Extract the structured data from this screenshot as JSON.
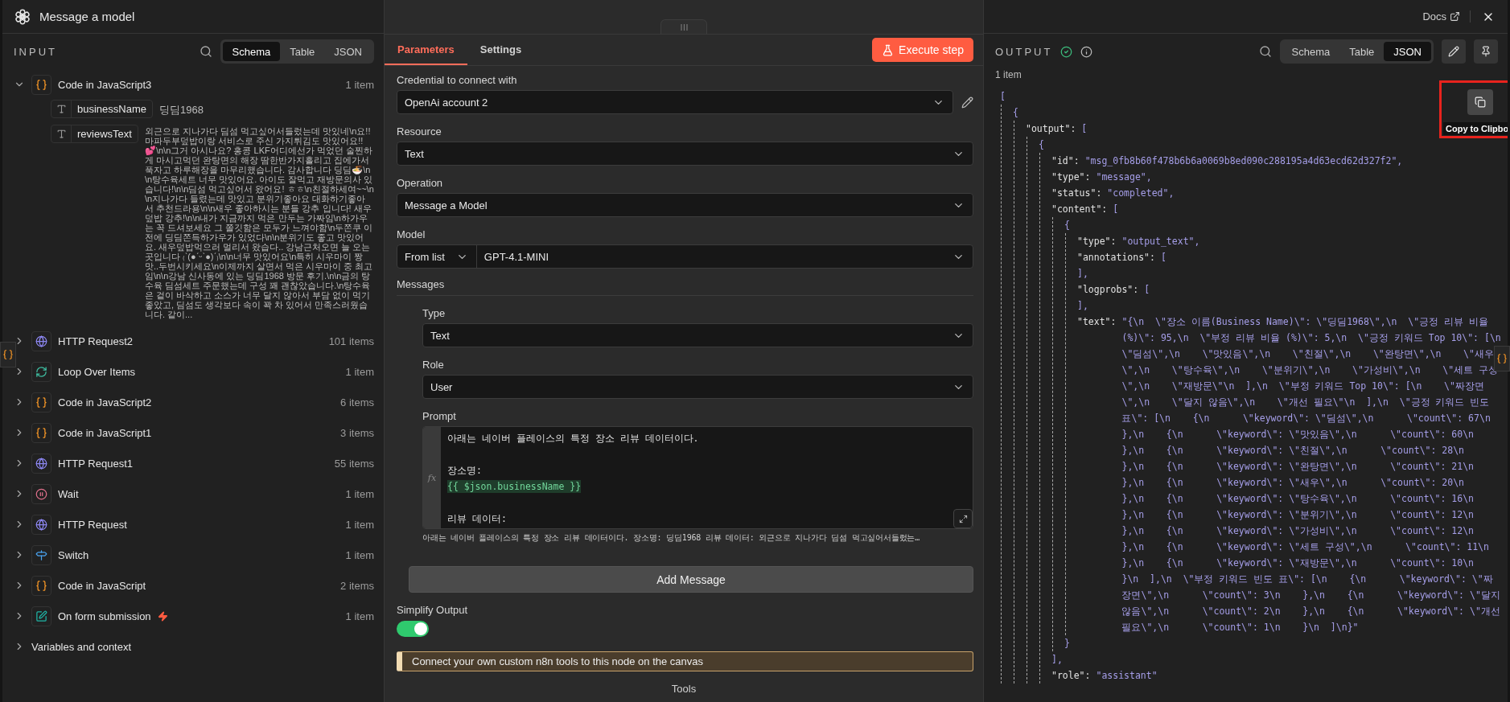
{
  "header": {
    "title": "Message a model",
    "docs": "Docs"
  },
  "input": {
    "title": "INPUT",
    "views": [
      {
        "label": "Schema",
        "selected": true
      },
      {
        "label": "Table",
        "selected": false
      },
      {
        "label": "JSON",
        "selected": false
      }
    ],
    "nodes": [
      {
        "kind": "code",
        "name": "Code in JavaScript3",
        "count": "1 item",
        "expanded": true,
        "trigger": false,
        "fields": [
          {
            "name": "businessName",
            "value": "딩딤1968"
          },
          {
            "name": "reviewsText",
            "value": "외근으로 지나가다 딤섬 먹고싶어서들렀는데 맛있네\\n요!! 마파두부덮밥이랑 서비스로 주신 가지튀김도 맛있어요!!💕\\n\\n그거 아시나요? 홍콩 LKF어디에선가 먹었던 술찐하게 마시고먹던 완탕면의 해장 땀한반가지흘리고 집에가서 푹자고 하루해장을 마무리했습니다. 감사합니다 딩딤🍜\\n\\n탕수육세트 너무 맛있어요. 아이도 잘먹고 재방문의사 있습니다!\\n\\n딤섬 먹고싶어서 왔어요! ㅎㅎ\\n친절하세여~~\\n\\n지나가다 들렸는데 맛있고 분위기좋아요 대화하기좋아서 추천드라용\\n\\n새우 좋아하시는 분들 강추 입니다! 새우덮밥 강추!\\n\\n내가 지금까지 먹은 만두는 가짜임\\n하가우는 꼭 드셔보세요 그 쫄깃함은 모두가 느껴야함\\n두쫀쿠 이전에 딩딤쫀득하가우가 있었다\\n\\n분위기도 좋고 맛있어요. 새우덮밥먹으러 멀리서 왔습다.. 강남근처오면 늘 오는 곳입니다 ₍ˋ(●ˊᵕˋ●)ˊ₎\\n\\n너무 맛있어요\\n특히 시우마이 짱맛..두번시키세요\\n이제까지 살면서 먹은 시우마이 중 최고임\\n\\n강남 신사동에 있는 딩딤1968 방문 후기.\\n\\n금의 탕수육 딤섬세트 주문했는데 구성 꽤 괜찮았습니다.\\n탕수육은 겉이 바삭하고 소스가 너무 달지 않아서 부담 없이 먹기 좋았고, 딤섬도 생각보다 속이 꽉 차 있어서 만족스러웠습니다. 같이..."
          }
        ]
      },
      {
        "kind": "http",
        "name": "HTTP Request2",
        "count": "101 items",
        "expanded": false,
        "trigger": false
      },
      {
        "kind": "loop",
        "name": "Loop Over Items",
        "count": "1 item",
        "expanded": false,
        "trigger": false
      },
      {
        "kind": "code",
        "name": "Code in JavaScript2",
        "count": "6 items",
        "expanded": false,
        "trigger": false
      },
      {
        "kind": "code",
        "name": "Code in JavaScript1",
        "count": "3 items",
        "expanded": false,
        "trigger": false
      },
      {
        "kind": "http",
        "name": "HTTP Request1",
        "count": "55 items",
        "expanded": false,
        "trigger": false
      },
      {
        "kind": "wait",
        "name": "Wait",
        "count": "1 item",
        "expanded": false,
        "trigger": false
      },
      {
        "kind": "http",
        "name": "HTTP Request",
        "count": "1 item",
        "expanded": false,
        "trigger": false
      },
      {
        "kind": "switch",
        "name": "Switch",
        "count": "1 item",
        "expanded": false,
        "trigger": false
      },
      {
        "kind": "code",
        "name": "Code in JavaScript",
        "count": "2 items",
        "expanded": false,
        "trigger": false
      },
      {
        "kind": "form",
        "name": "On form submission",
        "count": "1 item",
        "expanded": false,
        "trigger": true
      }
    ],
    "variables": {
      "label": "Variables and context",
      "expanded": false
    }
  },
  "parameters": {
    "tabs": [
      {
        "label": "Parameters",
        "selected": true
      },
      {
        "label": "Settings",
        "selected": false
      }
    ],
    "execute": "Execute step",
    "credential": {
      "label": "Credential to connect with",
      "value": "OpenAi account 2"
    },
    "resource": {
      "label": "Resource",
      "value": "Text"
    },
    "operation": {
      "label": "Operation",
      "value": "Message a Model"
    },
    "model": {
      "label": "Model",
      "mode": "From list",
      "value": "GPT-4.1-MINI"
    },
    "messages": {
      "label": "Messages",
      "type": {
        "label": "Type",
        "value": "Text"
      },
      "role": {
        "label": "Role",
        "value": "User"
      },
      "prompt": {
        "label": "Prompt",
        "gutter": "fx",
        "blocks": [
          [
            {
              "kind": "text",
              "text": "아래는 네이버 플레이스의 특정 장소 리뷰 데이터이다."
            }
          ],
          [
            {
              "kind": "text",
              "text": "장소명:"
            },
            {
              "kind": "expression",
              "text": "{{ $json.businessName }}"
            }
          ],
          [
            {
              "kind": "text",
              "text": "리뷰 데이터:"
            }
          ]
        ],
        "preview": "아래는 네이버 플레이스의 특정 장소 리뷰 데이터이다. 장소명: 딩딤1968 리뷰 데이터: 외근으로 지나가다 딤섬 먹고싶어서들렀는…"
      },
      "add": "Add Message"
    },
    "simplify": {
      "label": "Simplify Output",
      "on": true
    },
    "notice": "Connect your own custom n8n tools to this node on the canvas",
    "tools": "Tools"
  },
  "output": {
    "title": "OUTPUT",
    "views": [
      {
        "label": "Schema",
        "selected": false
      },
      {
        "label": "Table",
        "selected": false
      },
      {
        "label": "JSON",
        "selected": true
      }
    ],
    "count": "1 item",
    "copy_tooltip": "Copy to Clipbo",
    "json": [
      {
        "open": "[",
        "children": [
          {
            "open": "{",
            "children": [
              {
                "key": "\"output\":",
                "open": "[",
                "children": [
                  {
                    "open": "{",
                    "children": [
                      {
                        "key": "\"id\":",
                        "value": "\"msg_0fb8b60f478b6b6a0069b8ed090c288195a4d63ecd62d327f2\","
                      },
                      {
                        "key": "\"type\":",
                        "value": "\"message\","
                      },
                      {
                        "key": "\"status\":",
                        "value": "\"completed\","
                      },
                      {
                        "key": "\"content\":",
                        "open": "[",
                        "close": "],",
                        "children": [
                          {
                            "open": "{",
                            "close": "}",
                            "children": [
                              {
                                "key": "\"type\":",
                                "value": "\"output_text\","
                              },
                              {
                                "key": "\"annotations\":",
                                "open": "[",
                                "close": "],"
                              },
                              {
                                "key": "\"logprobs\":",
                                "open": "[",
                                "close": "],"
                              },
                              {
                                "key": "\"text\":",
                                "value": "\"{\\n  \\\"장소 이름(Business Name)\\\": \\\"딩딤1968\\\",\\n  \\\"긍정 리뷰 비율 (%)\\\": 95,\\n  \\\"부정 리뷰 비율 (%)\\\": 5,\\n  \\\"긍정 키워드 Top 10\\\": [\\n    \\\"딤섬\\\",\\n    \\\"맛있음\\\",\\n    \\\"친절\\\",\\n    \\\"완탕면\\\",\\n    \\\"새우\\\",\\n    \\\"탕수육\\\",\\n    \\\"분위기\\\",\\n    \\\"가성비\\\",\\n    \\\"세트 구성\\\",\\n    \\\"재방문\\\"\\n  ],\\n  \\\"부정 키워드 Top 10\\\": [\\n    \\\"짜장면\\\",\\n    \\\"달지 않음\\\",\\n    \\\"개선 필요\\\"\\n  ],\\n  \\\"긍정 키워드 빈도 표\\\": [\\n    {\\n      \\\"keyword\\\": \\\"딤섬\\\",\\n      \\\"count\\\": 67\\n    },\\n    {\\n      \\\"keyword\\\": \\\"맛있음\\\",\\n      \\\"count\\\": 60\\n    },\\n    {\\n      \\\"keyword\\\": \\\"친절\\\",\\n      \\\"count\\\": 28\\n    },\\n    {\\n      \\\"keyword\\\": \\\"완탕면\\\",\\n      \\\"count\\\": 21\\n    },\\n    {\\n      \\\"keyword\\\": \\\"새우\\\",\\n      \\\"count\\\": 20\\n    },\\n    {\\n      \\\"keyword\\\": \\\"탕수육\\\",\\n      \\\"count\\\": 16\\n    },\\n    {\\n      \\\"keyword\\\": \\\"분위기\\\",\\n      \\\"count\\\": 12\\n    },\\n    {\\n      \\\"keyword\\\": \\\"가성비\\\",\\n      \\\"count\\\": 12\\n    },\\n    {\\n      \\\"keyword\\\": \\\"세트 구성\\\",\\n      \\\"count\\\": 11\\n    },\\n    {\\n      \\\"keyword\\\": \\\"재방문\\\",\\n      \\\"count\\\": 10\\n    }\\n  ],\\n  \\\"부정 키워드 빈도 표\\\": [\\n    {\\n      \\\"keyword\\\": \\\"짜장면\\\",\\n      \\\"count\\\": 3\\n    },\\n    {\\n      \\\"keyword\\\": \\\"달지 않음\\\",\\n      \\\"count\\\": 2\\n    },\\n    {\\n      \\\"keyword\\\": \\\"개선 필요\\\",\\n      \\\"count\\\": 1\\n    }\\n  ]\\n}\""
                              }
                            ]
                          }
                        ]
                      },
                      {
                        "key": "\"role\":",
                        "value": "\"assistant\""
                      }
                    ]
                  }
                ]
              }
            ]
          }
        ]
      }
    ]
  }
}
